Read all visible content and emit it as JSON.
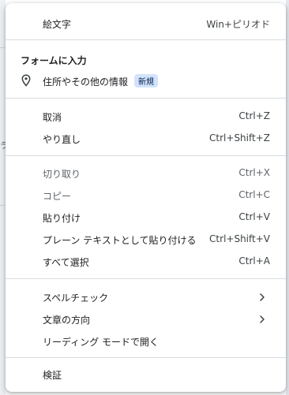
{
  "menu": {
    "emoji": {
      "label": "絵文字",
      "shortcut": "Win+ピリオド"
    },
    "autofill": {
      "header": "フォームに入力",
      "address": {
        "label": "住所やその他の情報",
        "badge": "新規"
      }
    },
    "undo": {
      "label": "取消",
      "shortcut": "Ctrl+Z"
    },
    "redo": {
      "label": "やり直し",
      "shortcut": "Ctrl+Shift+Z"
    },
    "cut": {
      "label": "切り取り",
      "shortcut": "Ctrl+X"
    },
    "copy": {
      "label": "コピー",
      "shortcut": "Ctrl+C"
    },
    "paste": {
      "label": "貼り付け",
      "shortcut": "Ctrl+V"
    },
    "paste_plain": {
      "label": "プレーン テキストとして貼り付ける",
      "shortcut": "Ctrl+Shift+V"
    },
    "select_all": {
      "label": "すべて選択",
      "shortcut": "Ctrl+A"
    },
    "spellcheck": {
      "label": "スペルチェック"
    },
    "writing_direction": {
      "label": "文章の方向"
    },
    "reading_mode": {
      "label": "リーディング モードで開く"
    },
    "inspect": {
      "label": "検証"
    }
  },
  "icons": {
    "address": "location-pin-icon",
    "submenu": "chevron-right-icon"
  },
  "colors": {
    "badge_bg": "#d3e3fd",
    "badge_text": "#041e49",
    "separator": "#dadce0"
  }
}
